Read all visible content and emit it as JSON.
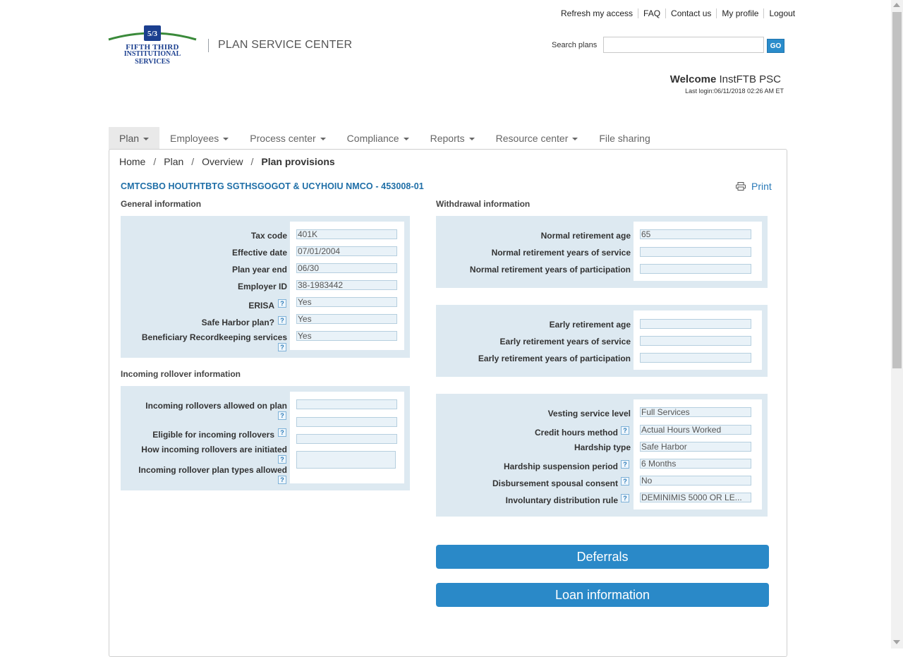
{
  "top_links": [
    "Refresh my access",
    "FAQ",
    "Contact us",
    "My profile",
    "Logout"
  ],
  "logo": {
    "line1": "FIFTH THIRD",
    "line2": "INSTITUTIONAL SERVICES"
  },
  "header": {
    "title": "PLAN SERVICE CENTER"
  },
  "search": {
    "label": "Search plans",
    "value": "",
    "go_label": "GO"
  },
  "welcome": {
    "word": "Welcome",
    "user": "InstFTB PSC",
    "last_login": "Last login:06/11/2018 02:26 AM ET"
  },
  "nav": [
    {
      "label": "Plan",
      "dropdown": true,
      "active": true
    },
    {
      "label": "Employees",
      "dropdown": true
    },
    {
      "label": "Process center",
      "dropdown": true
    },
    {
      "label": "Compliance",
      "dropdown": true
    },
    {
      "label": "Reports",
      "dropdown": true
    },
    {
      "label": "Resource center",
      "dropdown": true
    },
    {
      "label": "File sharing",
      "dropdown": false
    }
  ],
  "breadcrumb": {
    "home": "Home",
    "plan": "Plan",
    "overview": "Overview",
    "current": "Plan provisions",
    "sep": "/"
  },
  "plan_title": "CMTCSBO HOUTHTBTG SGTHSGOGOT & UCYHOIU NMCO - 453008-01",
  "print_label": "Print",
  "general": {
    "heading": "General information",
    "tax_code": {
      "label": "Tax code",
      "value": "401K"
    },
    "effective_date": {
      "label": "Effective date",
      "value": "07/01/2004"
    },
    "plan_year_end": {
      "label": "Plan year end",
      "value": "06/30"
    },
    "employer_id": {
      "label": "Employer ID",
      "value": "38-1983442"
    },
    "erisa": {
      "label": "ERISA",
      "value": "Yes"
    },
    "safe_harbor": {
      "label": "Safe Harbor plan?",
      "value": "Yes"
    },
    "beneficiary": {
      "label": "Beneficiary Recordkeeping services",
      "value": "Yes"
    }
  },
  "rollover": {
    "heading": "Incoming rollover information",
    "allowed": {
      "label": "Incoming rollovers allowed on plan",
      "value": ""
    },
    "eligible": {
      "label": "Eligible for incoming rollovers",
      "value": ""
    },
    "initiated": {
      "label": "How incoming rollovers are initiated",
      "value": ""
    },
    "plan_types": {
      "label": "Incoming rollover plan types allowed",
      "value": ""
    }
  },
  "withdrawal": {
    "heading": "Withdrawal information",
    "normal_age": {
      "label": "Normal retirement age",
      "value": "65"
    },
    "normal_service": {
      "label": "Normal retirement years of service",
      "value": ""
    },
    "normal_participation": {
      "label": "Normal retirement years of participation",
      "value": ""
    },
    "early_age": {
      "label": "Early retirement age",
      "value": ""
    },
    "early_service": {
      "label": "Early retirement years of service",
      "value": ""
    },
    "early_participation": {
      "label": "Early retirement years of participation",
      "value": ""
    },
    "vesting": {
      "label": "Vesting service level",
      "value": "Full Services"
    },
    "credit_hours": {
      "label": "Credit hours method",
      "value": "Actual Hours Worked"
    },
    "hardship_type": {
      "label": "Hardship type",
      "value": "Safe Harbor"
    },
    "hardship_suspension": {
      "label": "Hardship suspension period",
      "value": "6 Months"
    },
    "spousal_consent": {
      "label": "Disbursement spousal consent",
      "value": "No"
    },
    "involuntary": {
      "label": "Involuntary distribution rule",
      "value": "DEMINIMIS 5000 OR LE..."
    }
  },
  "help_glyph": "?",
  "buttons": {
    "deferrals": "Deferrals",
    "loan": "Loan information"
  },
  "colors": {
    "accent": "#2a89c8",
    "title_blue": "#1e6ea7",
    "box_bg": "#dde9f1",
    "logo_green": "#3a8a3a",
    "logo_navy": "#1b3f8f"
  }
}
